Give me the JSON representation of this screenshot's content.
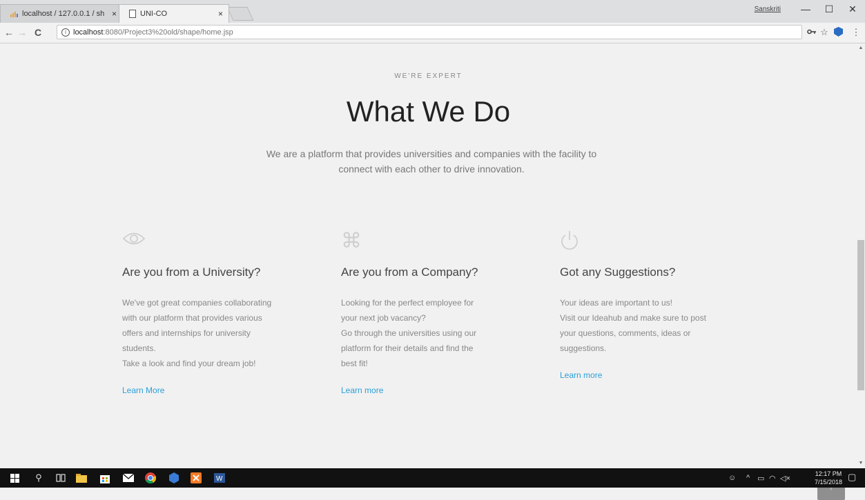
{
  "browser": {
    "tabs": [
      {
        "label": "localhost / 127.0.0.1 / sh",
        "close": "×"
      },
      {
        "label": "UNI-CO",
        "close": "×"
      }
    ],
    "user": "Sanskriti",
    "window_controls": {
      "minimize": "—",
      "maximize": "☐",
      "close": "✕"
    },
    "nav": {
      "back": "←",
      "forward": "→",
      "reload": "C"
    },
    "url": {
      "host": "localhost",
      "path": ":8080/Project3%20old/shape/home.jsp"
    }
  },
  "section": {
    "eyebrow": "WE'RE EXPERT",
    "title": "What We Do",
    "lead_line1": "We are a platform that provides universities and companies with the facility to",
    "lead_line2": "connect with each other to drive innovation."
  },
  "features": [
    {
      "icon": "eye-icon",
      "title": "Are you from a University?",
      "lines": [
        "We've got great companies collaborating",
        "with our platform that provides various",
        "offers and internships for university",
        "students.",
        "Take a look and find your dream job!"
      ],
      "link": "Learn More"
    },
    {
      "icon": "command-icon",
      "title": "Are you from a Company?",
      "lines": [
        "Looking for the perfect employee for",
        "your next job vacancy?",
        "Go through the universities using our",
        "platform for their details and find the",
        "best fit!"
      ],
      "link": "Learn more"
    },
    {
      "icon": "power-icon",
      "title": "Got any Suggestions?",
      "lines": [
        "Your ideas are important to us!",
        "Visit our Ideahub and make sure to post",
        "your questions, comments, ideas or",
        "suggestions."
      ],
      "link": "Learn more"
    }
  ],
  "scroll_top": "↑",
  "taskbar": {
    "time": "12:17 PM",
    "date": "7/15/2018"
  }
}
